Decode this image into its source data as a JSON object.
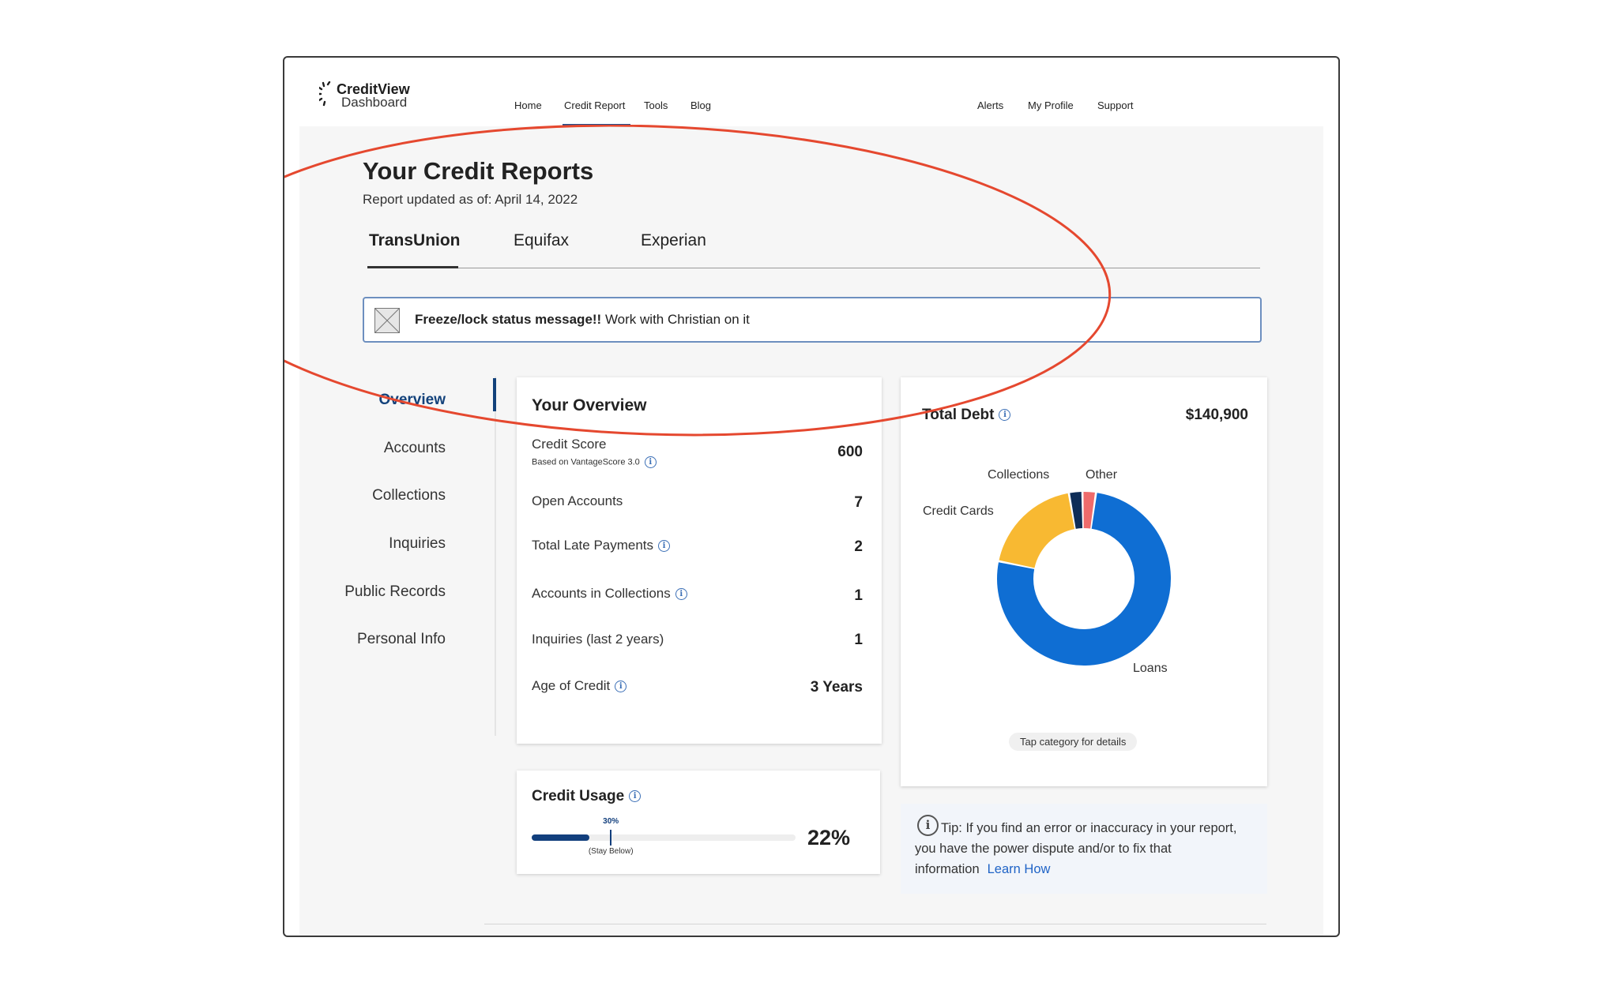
{
  "header": {
    "logo_line1": "CreditView",
    "logo_line2": "Dashboard",
    "nav_left": [
      "Home",
      "Credit Report",
      "Tools",
      "Blog"
    ],
    "nav_right": [
      "Alerts",
      "My Profile",
      "Support"
    ],
    "active_nav": "Credit Report"
  },
  "report": {
    "title": "Your Credit Reports",
    "updated": "Report updated as of: April 14, 2022",
    "tabs": [
      "TransUnion",
      "Equifax",
      "Experian"
    ],
    "active_tab": "TransUnion"
  },
  "alert": {
    "bold": "Freeze/lock status message!!",
    "text": " Work with Christian on it"
  },
  "sidebar": {
    "items": [
      "Overview",
      "Accounts",
      "Collections",
      "Inquiries",
      "Public Records",
      "Personal Info"
    ],
    "active": "Overview"
  },
  "overview": {
    "title": "Your Overview",
    "credit_score_label": "Credit Score",
    "credit_score_note": "Based on VantageScore 3.0",
    "credit_score_value": "600",
    "rows": [
      {
        "label": "Open Accounts",
        "value": "7"
      },
      {
        "label": "Total Late Payments",
        "value": "2"
      },
      {
        "label": "Accounts in Collections",
        "value": "1"
      },
      {
        "label": "Inquiries (last 2 years)",
        "value": "1"
      },
      {
        "label": "Age of Credit",
        "value": "3 Years"
      }
    ]
  },
  "usage": {
    "title": "Credit Usage",
    "marker_label": "30%",
    "marker_note": "(Stay Below)",
    "value_text": "22%",
    "value": 0.22,
    "marker": 0.3,
    "bar_color": "#123f7d"
  },
  "debt": {
    "title": "Total Debt",
    "total": "$140,900",
    "hint": "Tap category for details"
  },
  "chart_data": {
    "type": "pie",
    "style": "donut",
    "categories": [
      "Loans",
      "Credit Cards",
      "Collections",
      "Other"
    ],
    "values": [
      76,
      19,
      2.5,
      2.5
    ],
    "colors": [
      "#0f6ed3",
      "#f8b932",
      "#0e2d57",
      "#ef6b6b"
    ]
  },
  "tip": {
    "text": "Tip: If you find an error or inaccuracy in your report, you have the power dispute and/or to fix that information",
    "link": "Learn How"
  }
}
